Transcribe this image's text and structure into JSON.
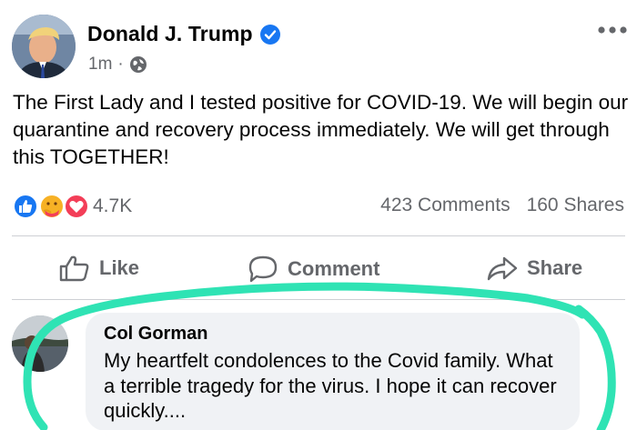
{
  "post": {
    "author": "Donald J. Trump",
    "time": "1m",
    "separator": "·",
    "text": "The First Lady and I tested positive for COVID-19. We will begin our quarantine and recovery process immediately. We will get through this TOGETHER!",
    "reaction_count": "4.7K",
    "comments_count": "423 Comments",
    "shares_count": "160 Shares"
  },
  "actions": {
    "like_label": "Like",
    "comment_label": "Comment",
    "share_label": "Share"
  },
  "comment": {
    "author": "Col Gorman",
    "text": "My heartfelt condolences to the Covid family. What a terrible tragedy for the virus. I hope it can recover quickly...."
  },
  "icons": {
    "verified": "verified-badge-icon",
    "privacy": "globe-icon",
    "more": "more-options-icon",
    "reactions": [
      "like-reaction-icon",
      "care-reaction-icon",
      "love-reaction-icon"
    ],
    "like": "thumbs-up-icon",
    "comment": "comment-bubble-icon",
    "share": "share-arrow-icon"
  },
  "colors": {
    "verified_blue": "#1877f2",
    "secondary_text": "#65676b",
    "bubble_bg": "#f0f2f5",
    "love_red": "#f33e58",
    "care_yellow": "#f7b125",
    "highlight_green": "#2fe3b4"
  }
}
